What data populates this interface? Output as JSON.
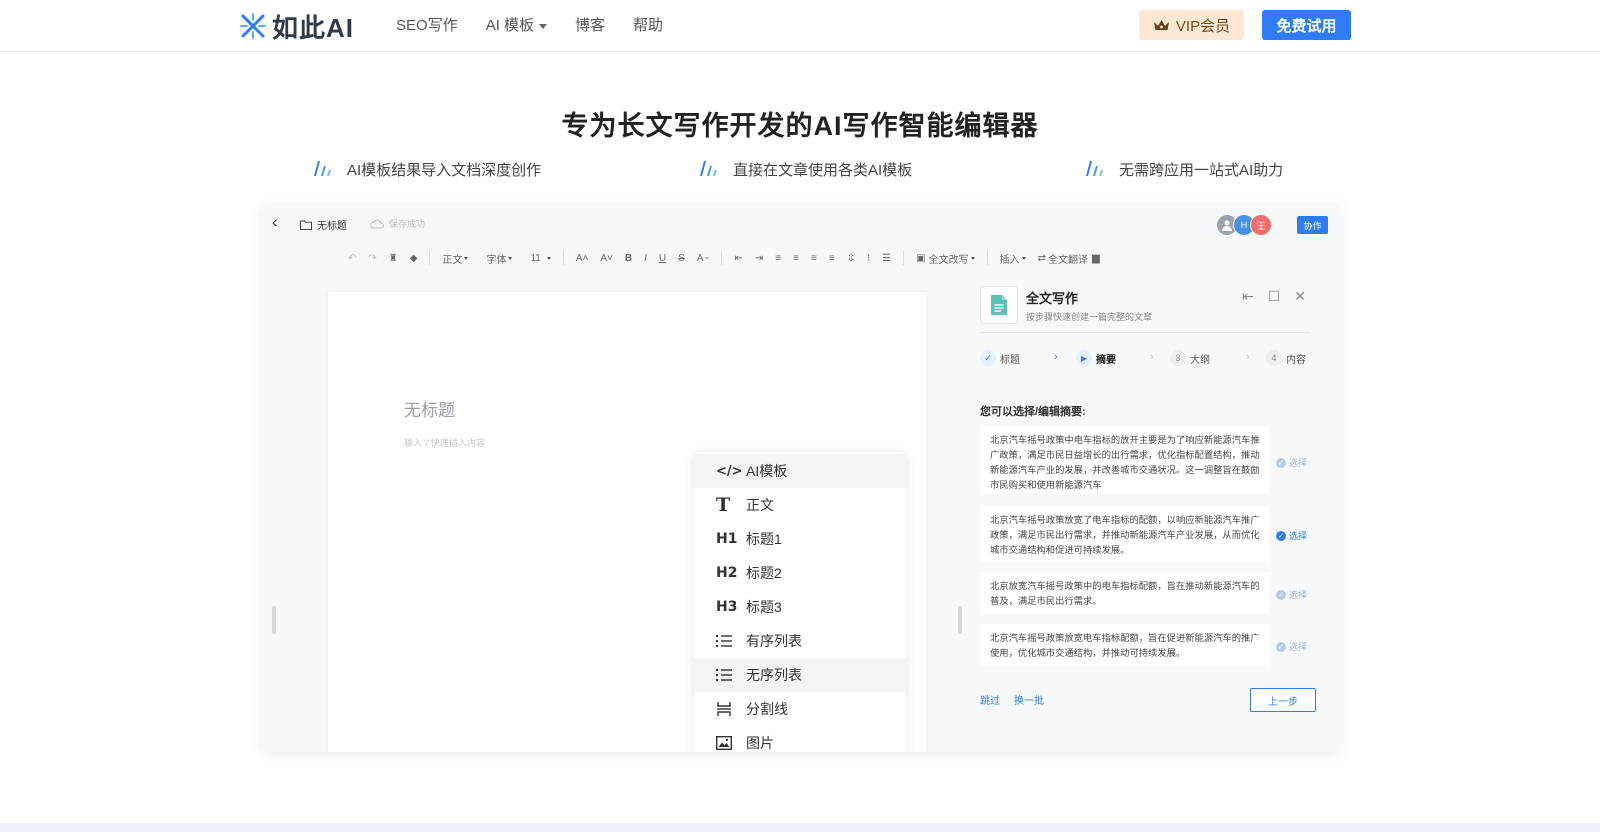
{
  "nav": {
    "logo_text": "如此AI",
    "links": [
      "SEO写作",
      "AI 模板",
      "博客",
      "帮助"
    ],
    "vip_label": "VIP会员",
    "free_trial_label": "免费试用"
  },
  "hero": {
    "title": "专为长文写作开发的AI写作智能编辑器",
    "features": [
      "AI模板结果导入文档深度创作",
      "直接在文章使用各类AI模板",
      "无需跨应用一站式AI助力"
    ]
  },
  "editor": {
    "doc_name": "无标题",
    "save_status": "保存成功",
    "avatars": [
      "H",
      "王"
    ],
    "collab_label": "协作",
    "toolbar": {
      "paragraph": "正文",
      "font": "字体",
      "size": "11",
      "full_rewrite": "全文改写",
      "insert": "插入",
      "full_translate": "全文翻译"
    },
    "doc_title_placeholder": "无标题",
    "doc_hint": "输入\"/\"快速插入内容",
    "menu": [
      {
        "icon": "</>",
        "label": "AI模板"
      },
      {
        "icon": "T",
        "label": "正文"
      },
      {
        "icon": "H1",
        "label": "标题1"
      },
      {
        "icon": "H2",
        "label": "标题2"
      },
      {
        "icon": "H3",
        "label": "标题3"
      },
      {
        "icon": "ordered-list-icon",
        "label": "有序列表"
      },
      {
        "icon": "bullet-list-icon",
        "label": "无序列表"
      },
      {
        "icon": "divider-icon",
        "label": "分割线"
      },
      {
        "icon": "image-icon",
        "label": "图片"
      }
    ],
    "panel": {
      "title": "全文写作",
      "subtitle": "按步骤快速创建一篇完整的文章",
      "steps": [
        {
          "num": "✓",
          "label": "标题"
        },
        {
          "num": "▶",
          "label": "摘要"
        },
        {
          "num": "3",
          "label": "大纲"
        },
        {
          "num": "4",
          "label": "内容"
        }
      ],
      "prompt": "您可以选择/编辑摘要:",
      "summaries": [
        "北京汽车摇号政策中电车指标的放开主要是为了响应新能源汽车推广政策，满足市民日益增长的出行需求，优化指标配置结构，推动新能源汽车产业的发展，并改善城市交通状况。这一调整旨在鼓励市民购买和使用新能源汽车",
        "北京汽车摇号政策放宽了电车指标的配额，以响应新能源汽车推广政策，满足市民出行需求，并推动新能源汽车产业发展，从而优化城市交通结构和促进可持续发展。",
        "北京放宽汽车摇号政策中的电车指标配额，旨在推动新能源汽车的普及，满足市民出行需求。",
        "北京汽车摇号政策放宽电车指标配额，旨在促进新能源汽车的推广使用，优化城市交通结构，并推动可持续发展。"
      ],
      "select_label": "选择",
      "skip_label": "跳过",
      "refresh_label": "换一批",
      "prev_label": "上一步"
    }
  },
  "colors": {
    "primary": "#2f7cf6",
    "vip_bg": "#fbe8d3"
  }
}
